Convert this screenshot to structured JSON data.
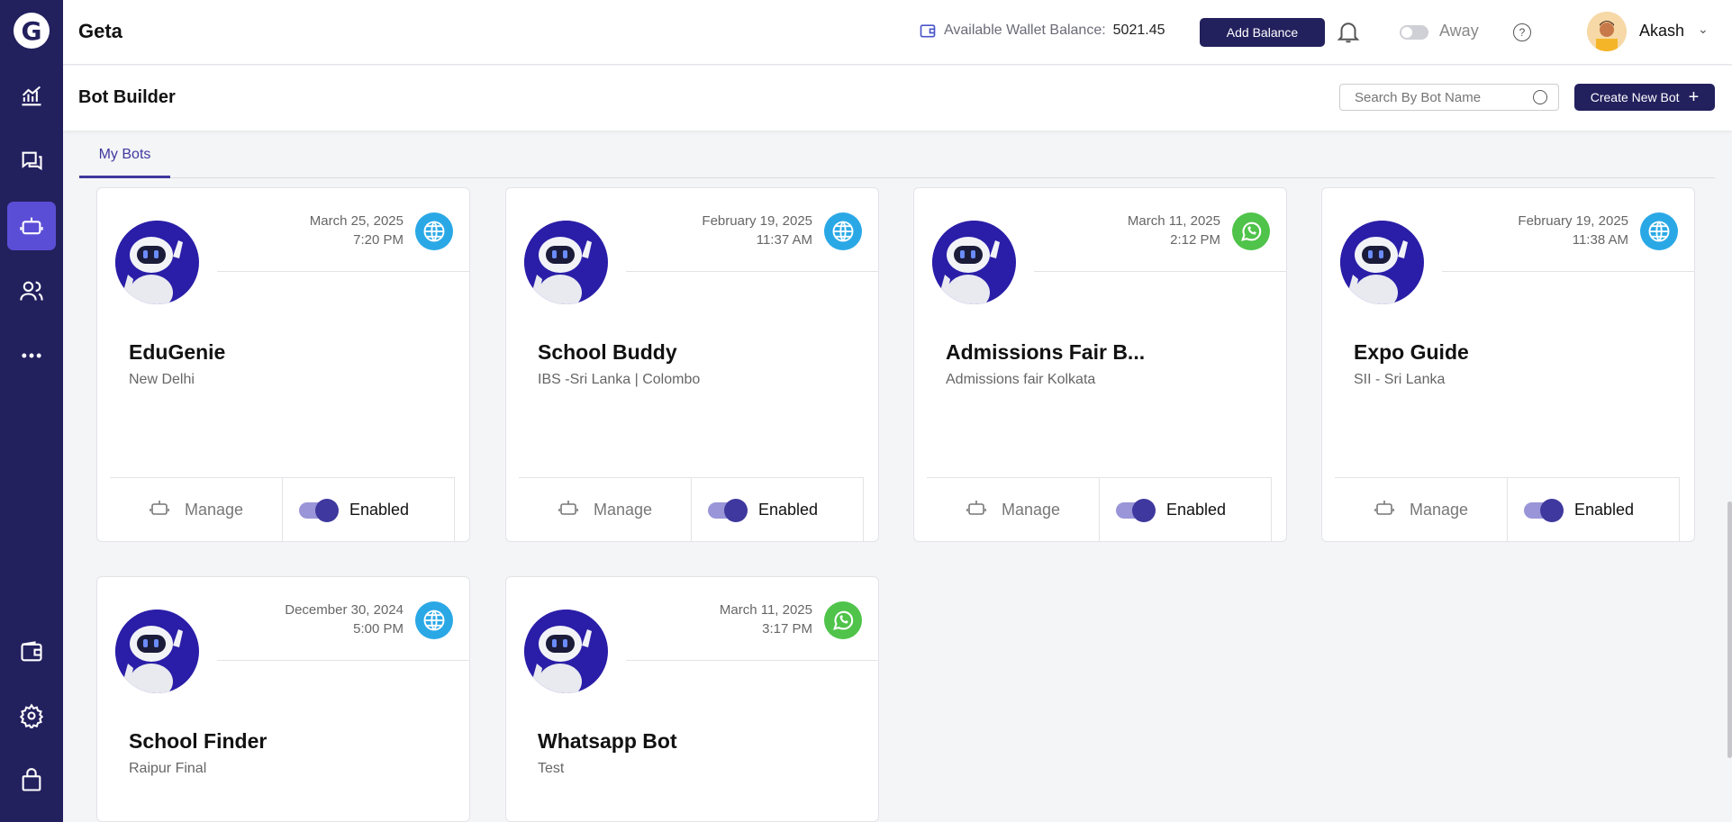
{
  "app": {
    "name": "Geta"
  },
  "topbar": {
    "wallet_label": "Available Wallet Balance:",
    "wallet_value": "5021.45",
    "add_balance": "Add Balance",
    "status": "Away",
    "user": "Akash"
  },
  "subheader": {
    "title": "Bot Builder",
    "search_placeholder": "Search By Bot Name",
    "create_button": "Create New Bot"
  },
  "tabs": [
    {
      "label": "My Bots",
      "active": true
    }
  ],
  "bots": [
    {
      "name": "EduGenie",
      "location": "New Delhi",
      "date": "March 25, 2025",
      "time": "7:20 PM",
      "channel": "web-icon",
      "manage": "Manage",
      "status": "Enabled"
    },
    {
      "name": "School Buddy",
      "location": "IBS -Sri Lanka | Colombo",
      "date": "February 19, 2025",
      "time": "11:37 AM",
      "channel": "web-icon",
      "manage": "Manage",
      "status": "Enabled"
    },
    {
      "name": "Admissions Fair B...",
      "location": "Admissions fair Kolkata",
      "date": "March 11, 2025",
      "time": "2:12 PM",
      "channel": "whatsapp-icon",
      "manage": "Manage",
      "status": "Enabled"
    },
    {
      "name": "Expo Guide",
      "location": "SII - Sri Lanka",
      "date": "February 19, 2025",
      "time": "11:38 AM",
      "channel": "web-icon",
      "manage": "Manage",
      "status": "Enabled"
    },
    {
      "name": "School Finder",
      "location": "Raipur Final",
      "date": "December 30, 2024",
      "time": "5:00 PM",
      "channel": "web-icon"
    },
    {
      "name": "Whatsapp Bot",
      "location": "Test",
      "date": "March 11, 2025",
      "time": "3:17 PM",
      "channel": "whatsapp-icon"
    }
  ],
  "colors": {
    "sidebar": "#23205e",
    "accent": "#3f389e",
    "active_nav": "#5b4ed6",
    "web": "#2aa8e6",
    "whatsapp": "#4fc34a"
  }
}
